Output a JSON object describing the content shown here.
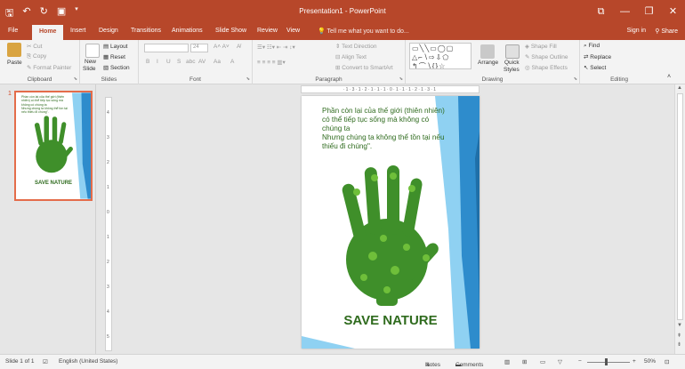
{
  "window": {
    "title": "Presentation1 - PowerPoint",
    "controls": [
      "⧉",
      "—",
      "❐",
      "✕"
    ]
  },
  "tabs": [
    "File",
    "Home",
    "Insert",
    "Design",
    "Transitions",
    "Animations",
    "Slide Show",
    "Review",
    "View"
  ],
  "active_tab": "Home",
  "tell_me": "Tell me what you want to do...",
  "account": {
    "sign_in": "Sign in",
    "share": "Share"
  },
  "ribbon": {
    "clipboard": {
      "label": "Clipboard",
      "paste": "Paste",
      "cut": "Cut",
      "copy": "Copy",
      "format_painter": "Format Painter"
    },
    "slides": {
      "label": "Slides",
      "new_slide_1": "New",
      "new_slide_2": "Slide",
      "layout": "Layout",
      "reset": "Reset",
      "section": "Section"
    },
    "font": {
      "label": "Font",
      "size": "24",
      "styles": [
        "B",
        "I",
        "U",
        "S",
        "abc",
        "AV",
        "Aa",
        "A"
      ]
    },
    "paragraph": {
      "label": "Paragraph",
      "text_direction": "Text Direction",
      "align_text": "Align Text",
      "smartart": "Convert to SmartArt"
    },
    "drawing": {
      "label": "Drawing",
      "arrange": "Arrange",
      "quick_1": "Quick",
      "quick_2": "Styles",
      "shape_fill": "Shape Fill",
      "shape_outline": "Shape Outline",
      "shape_effects": "Shape Effects"
    },
    "editing": {
      "label": "Editing",
      "find": "Find",
      "replace": "Replace",
      "select": "Select"
    }
  },
  "thumbnails": [
    {
      "number": "1",
      "caption": "SAVE NATURE"
    }
  ],
  "slide": {
    "text": "Phần còn lại của thế giới (thiên nhiên) có thể tiếp tục sống mà không có chúng ta\nNhưng chúng ta không thể tồn tại nếu thiếu đi chúng\".",
    "caption": "SAVE NATURE"
  },
  "rulers": {
    "horizontal": "·1·3·1·2·1·1·1·0·1·1·1·2·1·3·1",
    "vertical": [
      "4",
      "3",
      "2",
      "1",
      "0",
      "1",
      "2",
      "3",
      "4",
      "5"
    ]
  },
  "status": {
    "slide_info": "Slide 1 of 1",
    "language": "English (United States)",
    "notes": "Notes",
    "comments": "Comments",
    "zoom": "50%"
  },
  "colors": {
    "accent": "#b7472a",
    "leaf_green": "#3f8f2a",
    "blue_band": "#2e8ccc",
    "light_blue": "#8fd1f2"
  }
}
